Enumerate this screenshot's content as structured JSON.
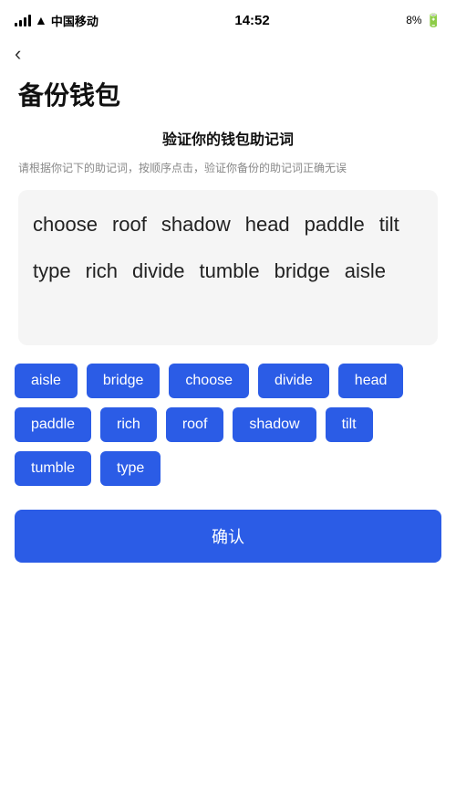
{
  "statusBar": {
    "carrier": "中国移动",
    "time": "14:52",
    "battery": "8%"
  },
  "nav": {
    "backLabel": "‹"
  },
  "page": {
    "title": "备份钱包",
    "sectionTitle": "验证你的钱包助记词",
    "sectionDesc": "请根据你记下的助记词，按顺序点击，验证你备份的助记词正确无误"
  },
  "displayWords": [
    "choose",
    "roof",
    "shadow",
    "head",
    "paddle",
    "tilt",
    "type",
    "rich",
    "divide",
    "tumble",
    "bridge",
    "aisle"
  ],
  "wordButtons": [
    "aisle",
    "bridge",
    "choose",
    "divide",
    "head",
    "paddle",
    "rich",
    "roof",
    "shadow",
    "tilt",
    "tumble",
    "type"
  ],
  "confirmLabel": "确认"
}
